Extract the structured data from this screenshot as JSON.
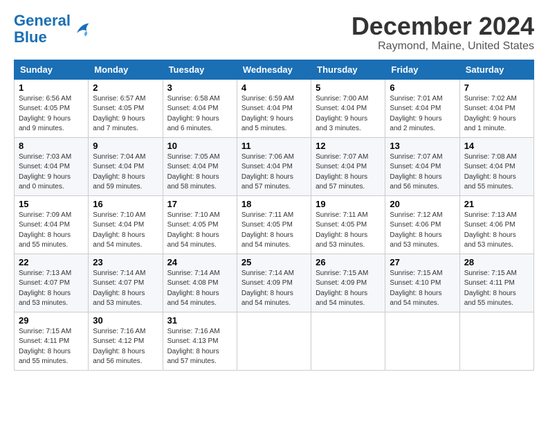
{
  "header": {
    "logo_line1": "General",
    "logo_line2": "Blue",
    "title": "December 2024",
    "subtitle": "Raymond, Maine, United States"
  },
  "weekdays": [
    "Sunday",
    "Monday",
    "Tuesday",
    "Wednesday",
    "Thursday",
    "Friday",
    "Saturday"
  ],
  "weeks": [
    [
      {
        "day": "1",
        "info": "Sunrise: 6:56 AM\nSunset: 4:05 PM\nDaylight: 9 hours\nand 9 minutes."
      },
      {
        "day": "2",
        "info": "Sunrise: 6:57 AM\nSunset: 4:05 PM\nDaylight: 9 hours\nand 7 minutes."
      },
      {
        "day": "3",
        "info": "Sunrise: 6:58 AM\nSunset: 4:04 PM\nDaylight: 9 hours\nand 6 minutes."
      },
      {
        "day": "4",
        "info": "Sunrise: 6:59 AM\nSunset: 4:04 PM\nDaylight: 9 hours\nand 5 minutes."
      },
      {
        "day": "5",
        "info": "Sunrise: 7:00 AM\nSunset: 4:04 PM\nDaylight: 9 hours\nand 3 minutes."
      },
      {
        "day": "6",
        "info": "Sunrise: 7:01 AM\nSunset: 4:04 PM\nDaylight: 9 hours\nand 2 minutes."
      },
      {
        "day": "7",
        "info": "Sunrise: 7:02 AM\nSunset: 4:04 PM\nDaylight: 9 hours\nand 1 minute."
      }
    ],
    [
      {
        "day": "8",
        "info": "Sunrise: 7:03 AM\nSunset: 4:04 PM\nDaylight: 9 hours\nand 0 minutes."
      },
      {
        "day": "9",
        "info": "Sunrise: 7:04 AM\nSunset: 4:04 PM\nDaylight: 8 hours\nand 59 minutes."
      },
      {
        "day": "10",
        "info": "Sunrise: 7:05 AM\nSunset: 4:04 PM\nDaylight: 8 hours\nand 58 minutes."
      },
      {
        "day": "11",
        "info": "Sunrise: 7:06 AM\nSunset: 4:04 PM\nDaylight: 8 hours\nand 57 minutes."
      },
      {
        "day": "12",
        "info": "Sunrise: 7:07 AM\nSunset: 4:04 PM\nDaylight: 8 hours\nand 57 minutes."
      },
      {
        "day": "13",
        "info": "Sunrise: 7:07 AM\nSunset: 4:04 PM\nDaylight: 8 hours\nand 56 minutes."
      },
      {
        "day": "14",
        "info": "Sunrise: 7:08 AM\nSunset: 4:04 PM\nDaylight: 8 hours\nand 55 minutes."
      }
    ],
    [
      {
        "day": "15",
        "info": "Sunrise: 7:09 AM\nSunset: 4:04 PM\nDaylight: 8 hours\nand 55 minutes."
      },
      {
        "day": "16",
        "info": "Sunrise: 7:10 AM\nSunset: 4:04 PM\nDaylight: 8 hours\nand 54 minutes."
      },
      {
        "day": "17",
        "info": "Sunrise: 7:10 AM\nSunset: 4:05 PM\nDaylight: 8 hours\nand 54 minutes."
      },
      {
        "day": "18",
        "info": "Sunrise: 7:11 AM\nSunset: 4:05 PM\nDaylight: 8 hours\nand 54 minutes."
      },
      {
        "day": "19",
        "info": "Sunrise: 7:11 AM\nSunset: 4:05 PM\nDaylight: 8 hours\nand 53 minutes."
      },
      {
        "day": "20",
        "info": "Sunrise: 7:12 AM\nSunset: 4:06 PM\nDaylight: 8 hours\nand 53 minutes."
      },
      {
        "day": "21",
        "info": "Sunrise: 7:13 AM\nSunset: 4:06 PM\nDaylight: 8 hours\nand 53 minutes."
      }
    ],
    [
      {
        "day": "22",
        "info": "Sunrise: 7:13 AM\nSunset: 4:07 PM\nDaylight: 8 hours\nand 53 minutes."
      },
      {
        "day": "23",
        "info": "Sunrise: 7:14 AM\nSunset: 4:07 PM\nDaylight: 8 hours\nand 53 minutes."
      },
      {
        "day": "24",
        "info": "Sunrise: 7:14 AM\nSunset: 4:08 PM\nDaylight: 8 hours\nand 54 minutes."
      },
      {
        "day": "25",
        "info": "Sunrise: 7:14 AM\nSunset: 4:09 PM\nDaylight: 8 hours\nand 54 minutes."
      },
      {
        "day": "26",
        "info": "Sunrise: 7:15 AM\nSunset: 4:09 PM\nDaylight: 8 hours\nand 54 minutes."
      },
      {
        "day": "27",
        "info": "Sunrise: 7:15 AM\nSunset: 4:10 PM\nDaylight: 8 hours\nand 54 minutes."
      },
      {
        "day": "28",
        "info": "Sunrise: 7:15 AM\nSunset: 4:11 PM\nDaylight: 8 hours\nand 55 minutes."
      }
    ],
    [
      {
        "day": "29",
        "info": "Sunrise: 7:15 AM\nSunset: 4:11 PM\nDaylight: 8 hours\nand 55 minutes."
      },
      {
        "day": "30",
        "info": "Sunrise: 7:16 AM\nSunset: 4:12 PM\nDaylight: 8 hours\nand 56 minutes."
      },
      {
        "day": "31",
        "info": "Sunrise: 7:16 AM\nSunset: 4:13 PM\nDaylight: 8 hours\nand 57 minutes."
      },
      null,
      null,
      null,
      null
    ]
  ]
}
